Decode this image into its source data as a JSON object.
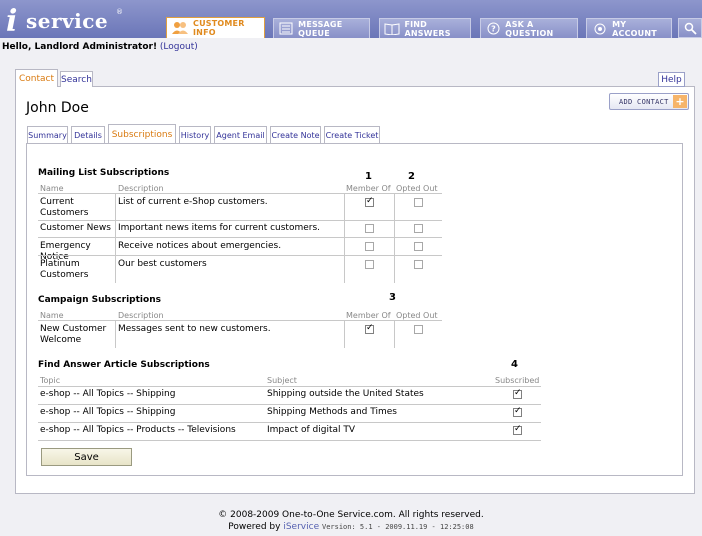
{
  "brand": {
    "logo_initial": "i",
    "logo_text": "service",
    "logo_reg": "®"
  },
  "nav": [
    {
      "label": "CUSTOMER INFO",
      "icon": "people-icon"
    },
    {
      "label": "MESSAGE QUEUE",
      "icon": "list-icon"
    },
    {
      "label": "FIND ANSWERS",
      "icon": "book-icon"
    },
    {
      "label": "ASK A QUESTION",
      "icon": "question-icon"
    },
    {
      "label": "MY ACCOUNT",
      "icon": "eye-icon"
    }
  ],
  "greeting": {
    "hello": "Hello, Landlord Administrator!",
    "logout": "(Logout)"
  },
  "top_tabs": {
    "contact": "Contact",
    "search": "Search",
    "help": "Help"
  },
  "contact": {
    "name": "John Doe",
    "add_contact": "ADD CONTACT",
    "add_plus": "+"
  },
  "sub_tabs": [
    "Summary",
    "Details",
    "Subscriptions",
    "History",
    "Agent Email",
    "Create Note",
    "Create Ticket"
  ],
  "mailing": {
    "title": "Mailing List Subscriptions",
    "col_name": "Name",
    "col_desc": "Description",
    "col_member": "Member Of",
    "col_opted": "Opted Out",
    "num_member": "1",
    "num_opted": "2",
    "rows": [
      {
        "name": "Current Customers",
        "desc": "List of current e-Shop customers.",
        "member": true,
        "opted": false
      },
      {
        "name": "Customer News",
        "desc": "Important news items for current customers.",
        "member": false,
        "opted": false
      },
      {
        "name": "Emergency Notice",
        "desc": "Receive notices about emergencies.",
        "member": false,
        "opted": false
      },
      {
        "name": "Platinum Customers",
        "desc": "Our best customers",
        "member": false,
        "opted": false
      }
    ]
  },
  "campaign": {
    "title": "Campaign Subscriptions",
    "col_name": "Name",
    "col_desc": "Description",
    "col_member": "Member Of",
    "col_opted": "Opted Out",
    "num": "3",
    "rows": [
      {
        "name": "New Customer Welcome",
        "desc": "Messages sent to new customers.",
        "member": true,
        "opted": false
      }
    ]
  },
  "articles": {
    "title": "Find Answer Article Subscriptions",
    "col_topic": "Topic",
    "col_subject": "Subject",
    "col_subscribed": "Subscribed",
    "num": "4",
    "rows": [
      {
        "topic": "e-shop -- All Topics -- Shipping",
        "subject": "Shipping outside the United States",
        "subscribed": true
      },
      {
        "topic": "e-shop -- All Topics -- Shipping",
        "subject": "Shipping Methods and Times",
        "subscribed": true
      },
      {
        "topic": "e-shop -- All Topics -- Products -- Televisions",
        "subject": "Impact of digital TV",
        "subscribed": true
      }
    ]
  },
  "save_label": "Save",
  "footer": {
    "copyright": "© 2008-2009 One-to-One Service.com. All rights reserved.",
    "powered": "Powered by",
    "brand": "iService",
    "version": "Version: 5.1 - 2009.11.19 - 12:25:08"
  }
}
